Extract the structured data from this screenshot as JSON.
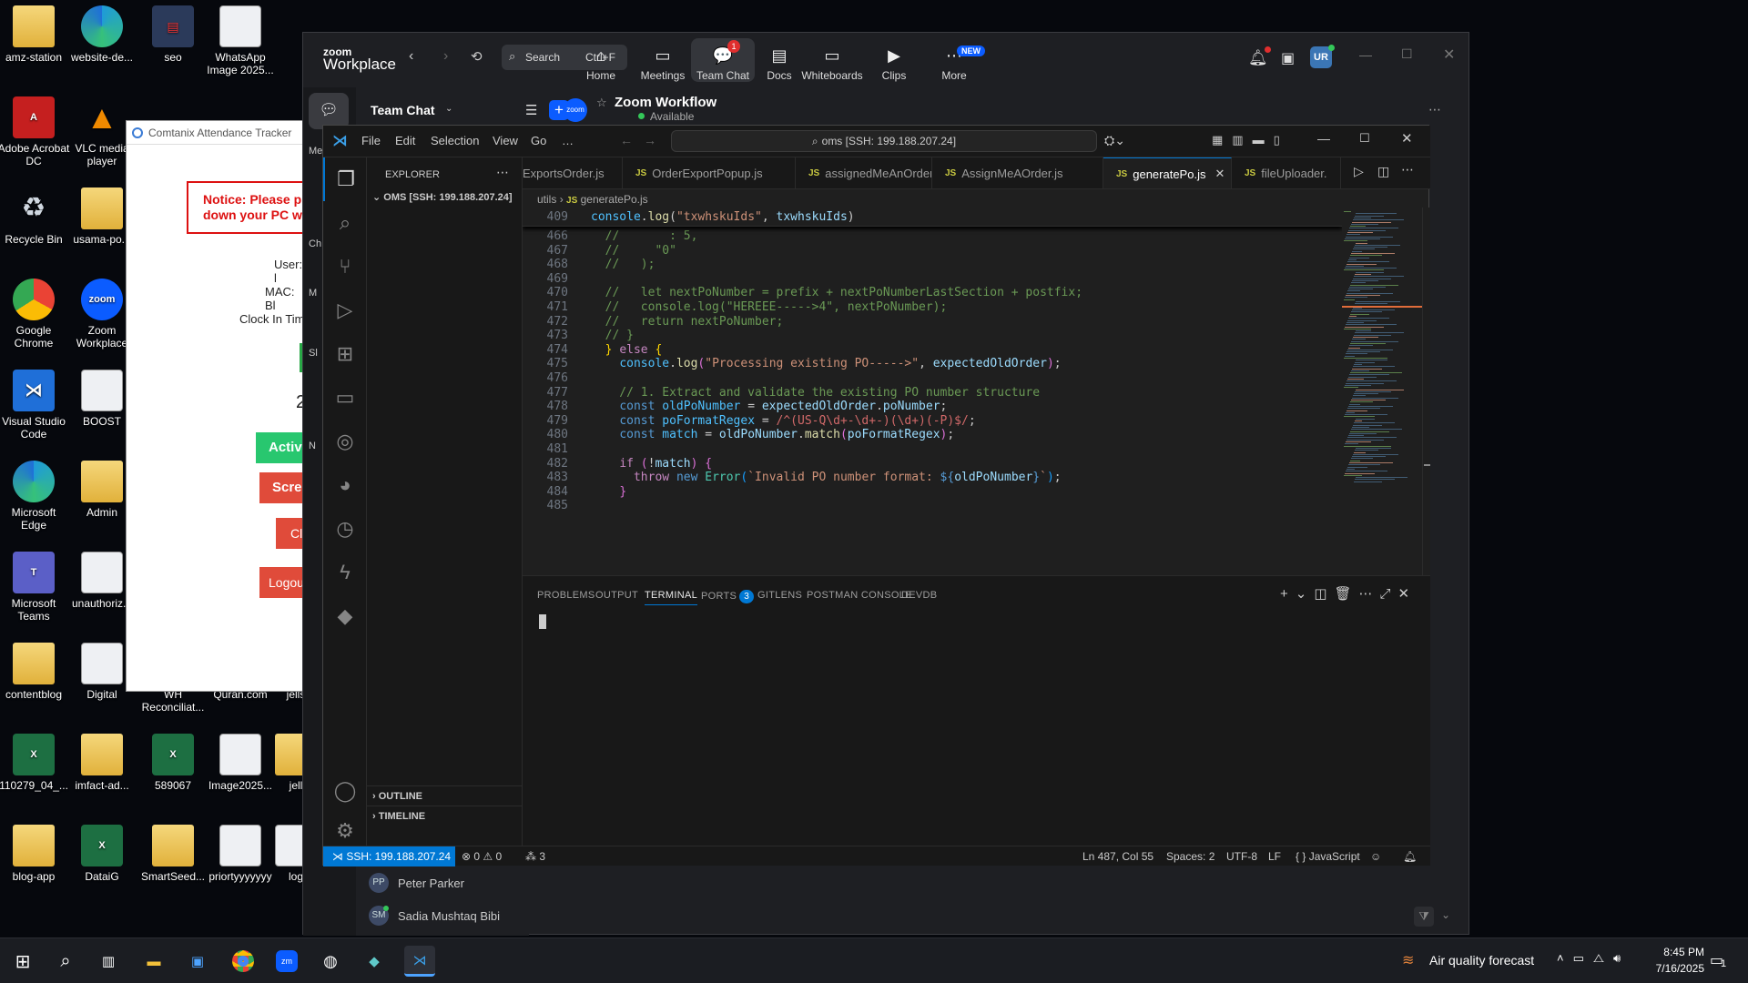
{
  "desktop": {
    "icons": [
      {
        "label": "amz-station",
        "kind": "folder"
      },
      {
        "label": "website-de...",
        "kind": "edge"
      },
      {
        "label": "seo",
        "kind": "app"
      },
      {
        "label": "WhatsApp Image 2025...",
        "kind": "doc"
      },
      {
        "label": "Adobe Acrobat DC",
        "kind": "pdf"
      },
      {
        "label": "VLC media player",
        "kind": "vlc"
      },
      {
        "label": "Recycle Bin",
        "kind": "bin"
      },
      {
        "label": "usama-po...",
        "kind": "folder"
      },
      {
        "label": "Google Chrome",
        "kind": "chrome"
      },
      {
        "label": "Zoom Workplace",
        "kind": "zoom"
      },
      {
        "label": "Visual Studio Code",
        "kind": "vscode"
      },
      {
        "label": "BOOST",
        "kind": "doc"
      },
      {
        "label": "Microsoft Edge",
        "kind": "edge"
      },
      {
        "label": "Admin",
        "kind": "folder"
      },
      {
        "label": "Microsoft Teams",
        "kind": "teams"
      },
      {
        "label": "unauthoriz...",
        "kind": "doc"
      },
      {
        "label": "contentblog",
        "kind": "folder"
      },
      {
        "label": "Digital",
        "kind": "doc"
      },
      {
        "label": "WH Reconciliat...",
        "kind": "folder"
      },
      {
        "label": "Quran.com",
        "kind": "folder"
      },
      {
        "label": "jells",
        "kind": "folder"
      },
      {
        "label": "110279_04_...",
        "kind": "xl"
      },
      {
        "label": "imfact-ad...",
        "kind": "folder"
      },
      {
        "label": "589067",
        "kind": "xl"
      },
      {
        "label": "Image2025...",
        "kind": "doc"
      },
      {
        "label": "jell",
        "kind": "folder"
      },
      {
        "label": "blog-app",
        "kind": "folder"
      },
      {
        "label": "DataiG",
        "kind": "xl"
      },
      {
        "label": "SmartSeed...",
        "kind": "folder"
      },
      {
        "label": "priortyyyyyyy",
        "kind": "doc"
      },
      {
        "label": "log",
        "kind": "doc"
      }
    ]
  },
  "attendance": {
    "title": "Comtanix Attendance Tracker",
    "notice": "Notice: Please pr\ndown your PC wh",
    "user": "User: l",
    "mac": "MAC: Bl",
    "clock": "Clock In Time",
    "big_num": "2",
    "active": "Active",
    "screen": "Scree",
    "cl": "Cl",
    "logout": "Logou"
  },
  "zoom": {
    "logo_top": "zoom",
    "logo_bottom": "Workplace",
    "search": "Search",
    "search_shortcut": "Ctrl+F",
    "nav": [
      {
        "label": "Home",
        "icon": "⌂"
      },
      {
        "label": "Meetings",
        "icon": "▭"
      },
      {
        "label": "Team Chat",
        "icon": "💬",
        "badge": "1"
      },
      {
        "label": "Docs",
        "icon": "▤"
      },
      {
        "label": "Whiteboards",
        "icon": "▭"
      },
      {
        "label": "Clips",
        "icon": "▶"
      },
      {
        "label": "More",
        "icon": "⋯",
        "badge": "NEW"
      }
    ],
    "avatar": "UR",
    "panel_title": "Team Chat",
    "chat_title": "Zoom Workflow",
    "chat_status": "Available",
    "zoom_badge": "zoom",
    "left_rail": [
      "Me",
      "Ch",
      "M",
      "Sl",
      "N"
    ],
    "contacts": [
      {
        "initials": "PP",
        "name": "Peter Parker"
      },
      {
        "initials": "SM",
        "name": "Sadia Mushtaq Bibi"
      }
    ]
  },
  "vscode": {
    "menu": [
      "File",
      "Edit",
      "Selection",
      "View",
      "Go",
      "…"
    ],
    "command_center": "oms [SSH: 199.188.207.24]",
    "explorer_title": "EXPLORER",
    "explorer_root": "OMS [SSH: 199.188.207.24]",
    "outline": "OUTLINE",
    "timeline": "TIMELINE",
    "tabs": [
      "ExportsOrder.js",
      "OrderExportPopup.js",
      "assignedMeAnOrder.js",
      "AssignMeAOrder.js",
      "generatePo.js",
      "fileUploader."
    ],
    "breadcrumb": [
      "utils",
      "generatePo.js"
    ],
    "sticky": {
      "num": "409",
      "code": "console.log(\"txwhskuIds\", txwhskuIds)"
    },
    "lines": [
      {
        "n": "466",
        "t": "  //       : 5,",
        "c": "cm"
      },
      {
        "n": "467",
        "t": "  //     \"0\"",
        "c": "cm"
      },
      {
        "n": "468",
        "t": "  //   );",
        "c": "cm"
      },
      {
        "n": "469",
        "t": "",
        "c": ""
      },
      {
        "n": "470",
        "t": "  //   let nextPoNumber = prefix + nextPoNumberLastSection + postfix;",
        "c": "cm"
      },
      {
        "n": "471",
        "t": "  //   console.log(\"HEREEE----->4\", nextPoNumber);",
        "c": "cm"
      },
      {
        "n": "472",
        "t": "  //   return nextPoNumber;",
        "c": "cm"
      },
      {
        "n": "473",
        "t": "  // }",
        "c": "cm"
      },
      {
        "n": "474",
        "t": "  } else {",
        "c": "else"
      },
      {
        "n": "475",
        "t": "    console.log(\"Processing existing PO----->\", expectedOldOrder);",
        "c": "log"
      },
      {
        "n": "476",
        "t": "",
        "c": ""
      },
      {
        "n": "477",
        "t": "    // 1. Extract and validate the existing PO number structure",
        "c": "cm"
      },
      {
        "n": "478",
        "t": "    const oldPoNumber = expectedOldOrder.poNumber;",
        "c": "c478"
      },
      {
        "n": "479",
        "t": "    const poFormatRegex = /^(US-Q\\d+-\\d+-)(\\d+)(-P)$/;",
        "c": "c479"
      },
      {
        "n": "480",
        "t": "    const match = oldPoNumber.match(poFormatRegex);",
        "c": "c480"
      },
      {
        "n": "481",
        "t": "",
        "c": ""
      },
      {
        "n": "482",
        "t": "    if (!match) {",
        "c": "c482"
      },
      {
        "n": "483",
        "t": "      throw new Error(`Invalid PO number format: ${oldPoNumber}`);",
        "c": "c483"
      },
      {
        "n": "484",
        "t": "    }",
        "c": "brace"
      },
      {
        "n": "485",
        "t": "",
        "c": ""
      }
    ],
    "panel_tabs": [
      "PROBLEMS",
      "OUTPUT",
      "TERMINAL",
      "PORTS",
      "GITLENS",
      "POSTMAN CONSOLE",
      "DEVDB"
    ],
    "ports_count": "3",
    "status": {
      "remote": "SSH: 199.188.207.24",
      "errors": "0",
      "warnings": "0",
      "ports": "3",
      "position": "Ln 487, Col 55",
      "spaces": "Spaces: 2",
      "encoding": "UTF-8",
      "eol": "LF",
      "language": "JavaScript"
    }
  },
  "taskbar": {
    "weather": "Air quality forecast",
    "time": "8:45 PM",
    "date": "7/16/2025",
    "notif": "1"
  },
  "colors": {
    "vs_accent": "#0078d4",
    "zoom_blue": "#0b5cff",
    "status_remote": "#0078d4"
  }
}
